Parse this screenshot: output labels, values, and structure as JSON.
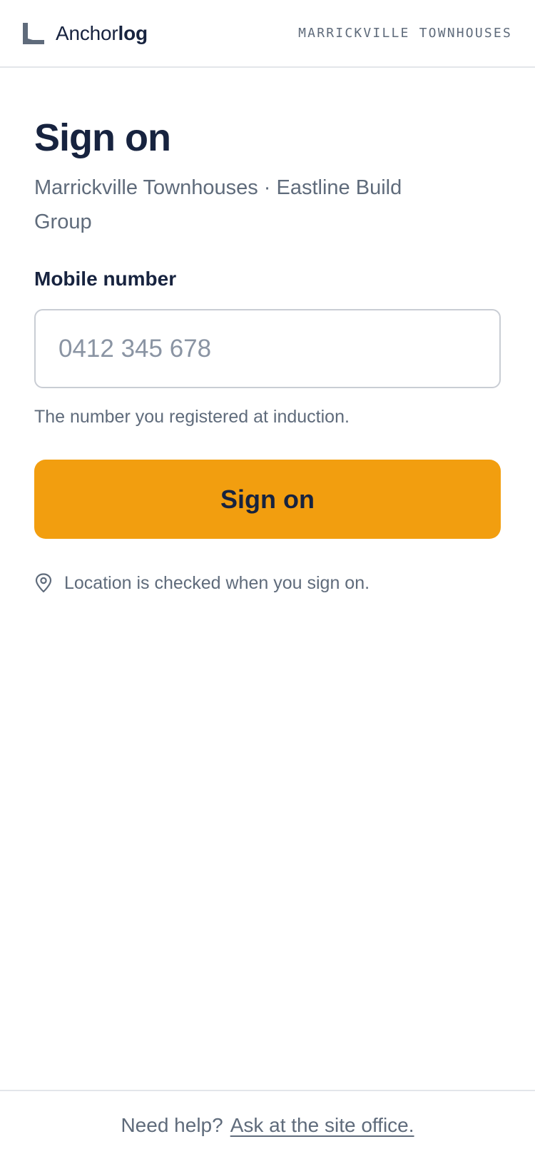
{
  "header": {
    "brand_regular": "Anchor",
    "brand_bold": "log",
    "site_code": "MARRICKVILLE TOWNHOUSES"
  },
  "main": {
    "title": "Sign on",
    "subtitle": "Marrickville Townhouses · Eastline Build Group",
    "mobile_label": "Mobile number",
    "mobile_placeholder": "0412 345 678",
    "mobile_value": "",
    "mobile_help": "The number you registered at induction.",
    "signon_button_label": "Sign on",
    "location_note": "Location is checked when you sign on."
  },
  "footer": {
    "help_prefix": "Need help?",
    "help_link": "Ask at the site office."
  },
  "colors": {
    "primary_button": "#f29e0f",
    "heading": "#17233f",
    "muted_text": "#5f6b7b",
    "divider": "#e3e6ea"
  },
  "icons": {
    "logo": "anchorlog-logo-icon",
    "location": "map-pin-icon"
  }
}
